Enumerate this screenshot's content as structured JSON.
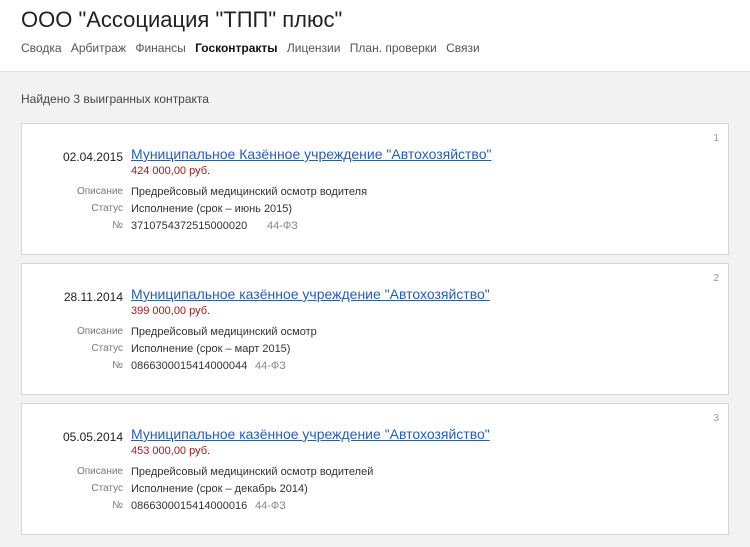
{
  "company": {
    "title": "ООО \"Ассоциация \"ТПП\" плюс\""
  },
  "nav": {
    "tabs": [
      {
        "label": "Сводка"
      },
      {
        "label": "Арбитраж"
      },
      {
        "label": "Финансы"
      },
      {
        "label": "Госконтракты",
        "active": true
      },
      {
        "label": "Лицензии"
      },
      {
        "label": "План. проверки"
      },
      {
        "label": "Связи"
      }
    ]
  },
  "summary": "Найдено 3 выигранных контракта",
  "labels": {
    "description": "Описание",
    "status": "Статус",
    "number": "№"
  },
  "contracts": [
    {
      "index": "1",
      "date": "02.04.2015",
      "customer": "Муниципальное Казённое учреждение \"Автохозяйство\"",
      "price": "424 000,00 руб.",
      "description": "Предрейсовый медицинский осмотр водителя",
      "status": "Исполнение (срок – июнь 2015)",
      "number": "3710754372515000020",
      "law": "44-ФЗ"
    },
    {
      "index": "2",
      "date": "28.11.2014",
      "customer": "Муниципальное казённое учреждение \"Автохозяйство\"",
      "price": "399 000,00 руб.",
      "description": "Предрейсовый медицинский осмотр",
      "status": "Исполнение (срок – март 2015)",
      "number": "0866300015414000044",
      "law": "44-ФЗ"
    },
    {
      "index": "3",
      "date": "05.05.2014",
      "customer": "Муниципальное казённое учреждение \"Автохозяйство\"",
      "price": "453 000,00 руб.",
      "description": "Предрейсовый медицинский осмотр водителей",
      "status": "Исполнение (срок – декабрь 2014)",
      "number": "0866300015414000016",
      "law": "44-ФЗ"
    }
  ]
}
